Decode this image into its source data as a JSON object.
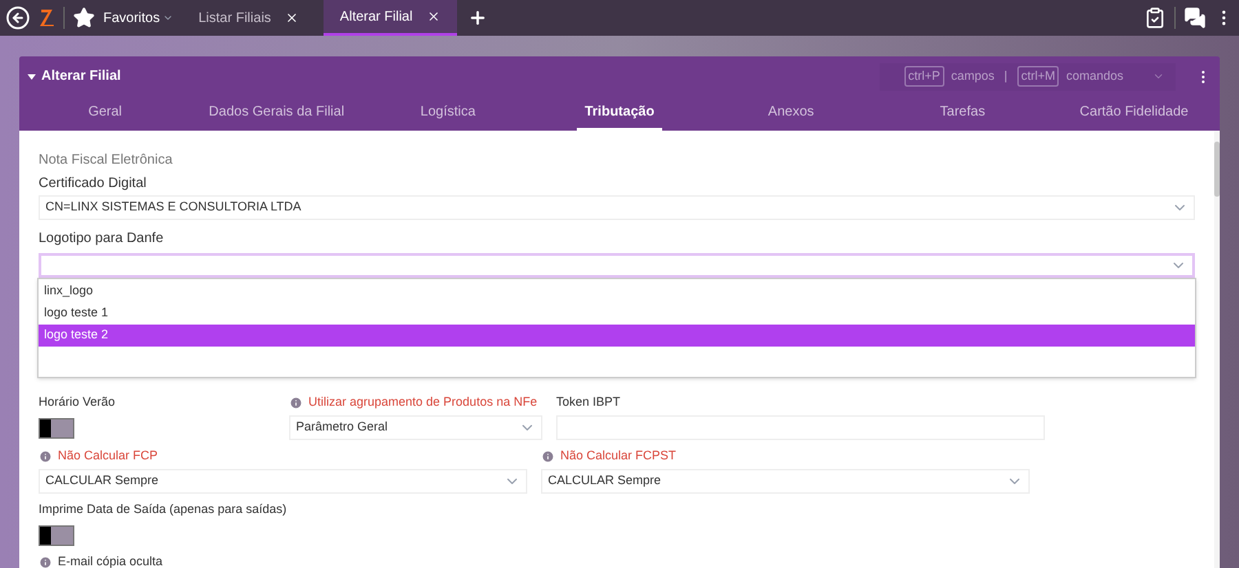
{
  "topbar": {
    "favorites": "Favoritos",
    "tabs": [
      {
        "label": "Listar Filiais",
        "selected": false
      },
      {
        "label": "Alterar Filial",
        "selected": true
      }
    ]
  },
  "panel": {
    "title": "Alterar Filial",
    "shortcuts": [
      {
        "key": "ctrl+P",
        "label": "campos"
      },
      {
        "key": "ctrl+M",
        "label": "comandos"
      }
    ],
    "separator": "|"
  },
  "tabs": [
    {
      "label": "Geral",
      "selected": false
    },
    {
      "label": "Dados Gerais da Filial",
      "selected": false
    },
    {
      "label": "Logística",
      "selected": false
    },
    {
      "label": "Tributação",
      "selected": true
    },
    {
      "label": "Anexos",
      "selected": false
    },
    {
      "label": "Tarefas",
      "selected": false
    },
    {
      "label": "Cartão Fidelidade",
      "selected": false
    }
  ],
  "section_title": "Nota Fiscal Eletrônica",
  "certificate": {
    "label": "Certificado Digital",
    "value": "CN=LINX SISTEMAS E CONSULTORIA LTDA"
  },
  "logo": {
    "label": "Logotipo para Danfe",
    "expanded": true,
    "options": [
      {
        "label": "linx_logo",
        "selected": false
      },
      {
        "label": "logo teste 1",
        "selected": false
      },
      {
        "label": "logo teste 2",
        "selected": true
      }
    ]
  },
  "fields": [
    [
      {
        "kind": "toggle",
        "label": "Horário Verão",
        "on": false,
        "info": false,
        "required": false
      },
      {
        "kind": "select",
        "label": "Utilizar agrupamento de Produtos na NFe",
        "value": "Parâmetro Geral",
        "info": true,
        "required": true
      },
      {
        "kind": "text",
        "label": "Token IBPT",
        "info": false,
        "required": false
      }
    ],
    [
      {
        "kind": "select",
        "label": "Não Calcular FCP",
        "value": "CALCULAR Sempre",
        "info": true,
        "required": true
      },
      {
        "kind": "select",
        "label": "Não Calcular FCPST",
        "value": "CALCULAR Sempre",
        "info": true,
        "required": true
      }
    ],
    [
      {
        "kind": "toggle",
        "label": "Imprime Data de Saída (apenas para saídas)",
        "on": false,
        "info": false,
        "required": false
      }
    ],
    [
      {
        "kind": "label",
        "label": "E-mail cópia oculta",
        "info": true,
        "required": false
      }
    ]
  ]
}
